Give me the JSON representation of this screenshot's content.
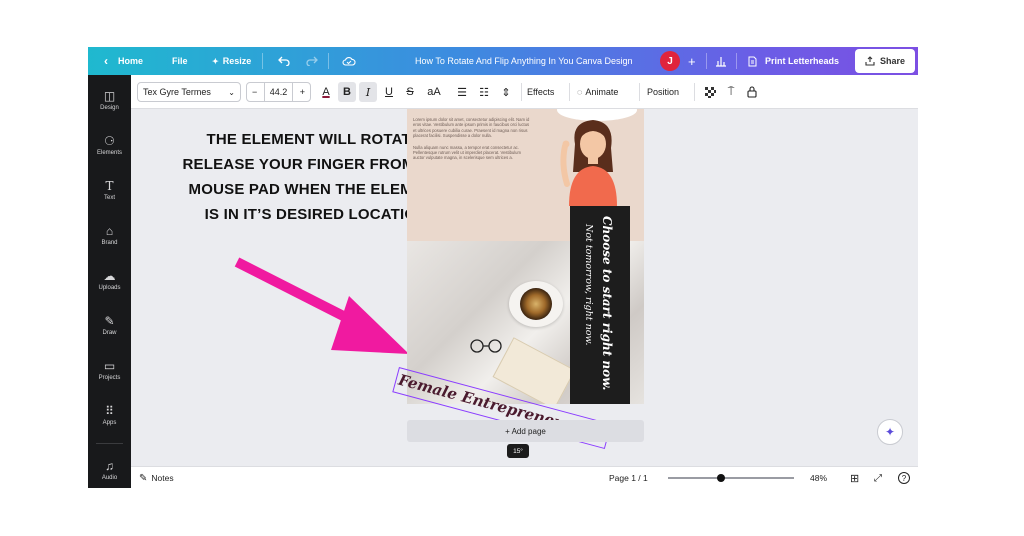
{
  "topbar": {
    "home_label": "Home",
    "file_label": "File",
    "resize_label": "Resize",
    "doc_title": "How To Rotate And Flip Anything In You Canva Design",
    "avatar_initial": "J",
    "print_label": "Print Letterheads",
    "share_label": "Share"
  },
  "sidebar": {
    "items": [
      {
        "label": "Design",
        "icon": "layout-icon"
      },
      {
        "label": "Elements",
        "icon": "shapes-icon"
      },
      {
        "label": "Text",
        "icon": "text-icon"
      },
      {
        "label": "Brand",
        "icon": "brand-icon"
      },
      {
        "label": "Uploads",
        "icon": "upload-icon"
      },
      {
        "label": "Draw",
        "icon": "pen-icon"
      },
      {
        "label": "Projects",
        "icon": "folder-icon"
      },
      {
        "label": "Apps",
        "icon": "apps-icon"
      },
      {
        "label": "Audio",
        "icon": "music-icon"
      }
    ]
  },
  "toolbar": {
    "font_name": "Tex Gyre Termes",
    "font_size": "44.2",
    "effects_label": "Effects",
    "animate_label": "Animate",
    "position_label": "Position",
    "text_color": "#8b1a3a"
  },
  "canvas": {
    "instruction": "THE ELEMENT WILL ROTATE. RELEASE YOUR FINGER FROM THE MOUSE PAD WHEN THE ELEMENT IS IN IT’S DESIRED LOCATION",
    "lorem_1": "Lorem ipsum dolor sit amet, consectetur adipiscing elit. Nam id eros vitae. Vestibulum ante ipsum primis in faucibus orci luctus et ultrices posuere cubilia curae. Praesent id magna non risus placerat facilisi. Suspendisse a dolor nulla.",
    "lorem_2": "Nulla aliquam nunc massa, a tempor erat consectetur ac. Pellentesque rutrum velit ut imperdiet placerat. Vestibulum auctor vulputate magna, in scelerisque sem ultrices a.",
    "vertical_line_1": "Choose to start right now.",
    "vertical_line_2": "Not tomorrow, right now.",
    "rotated_text": "Female Entrepreneur S",
    "add_page_label": "+ Add page",
    "rotation_badge": "15°"
  },
  "bottombar": {
    "notes_label": "Notes",
    "page_indicator": "Page 1 / 1",
    "zoom_level": "48%",
    "zoom_fraction": 0.42
  },
  "colors": {
    "accent": "#8b3dff",
    "arrow": "#f01aa0",
    "avatar": "#e0243c"
  }
}
